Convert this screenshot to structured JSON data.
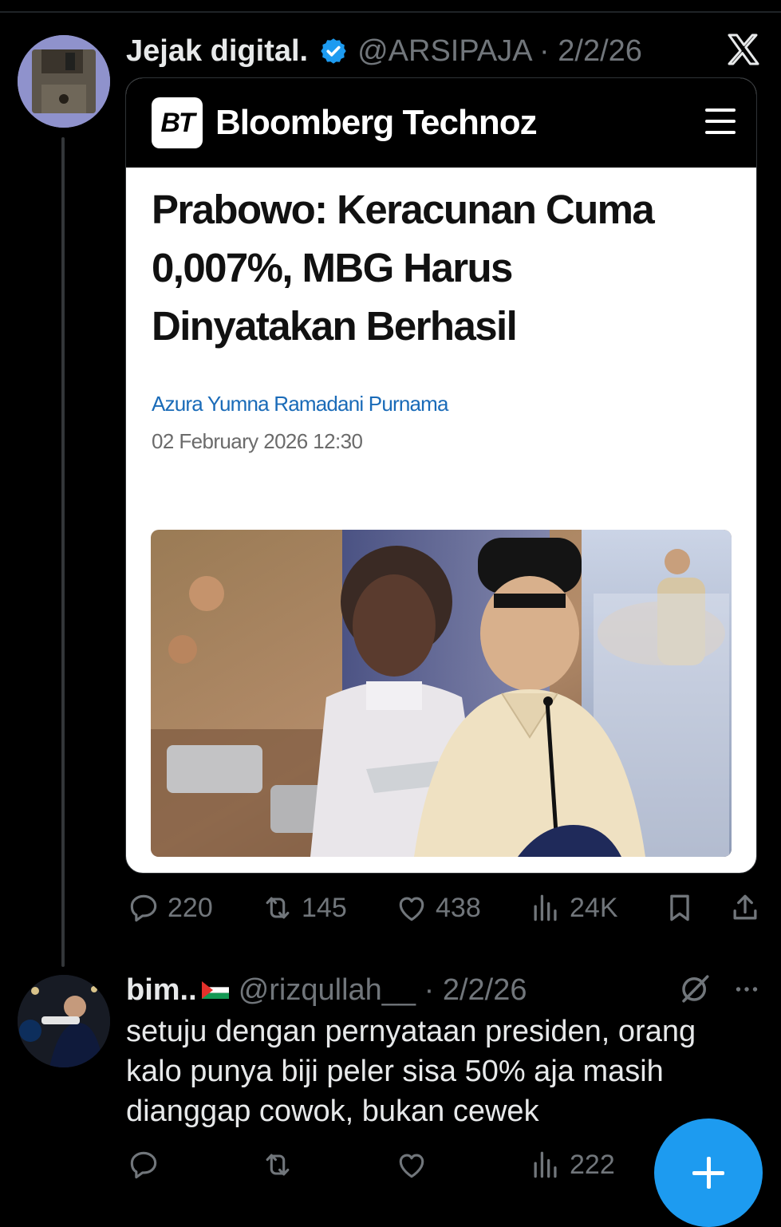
{
  "tweet": {
    "author_name": "Jejak digital.",
    "handle_date": "@ARSIPAJA · 2/2/26",
    "card": {
      "logo_text": "BT",
      "brand": "Bloomberg Technoz",
      "headline": "Prabowo: Keracunan Cuma 0,007%, MBG Harus Dinyatakan Berhasil",
      "author": "Azura Yumna Ramadani Purnama",
      "date": "02 February 2026 12:30"
    },
    "stats": {
      "replies": "220",
      "reposts": "145",
      "likes": "438",
      "views": "24K"
    }
  },
  "reply": {
    "author_name": "bim..",
    "handle_date": "@rizqullah__ · 2/2/26",
    "text": "setuju dengan pernyataan presiden, orang kalo punya biji peler sisa 50% aja masih dianggap cowok, bukan cewek",
    "stats": {
      "views": "222"
    }
  },
  "colors": {
    "accent": "#1d9bf0",
    "secondary_text": "#71767b",
    "link": "#1a6bb8"
  }
}
